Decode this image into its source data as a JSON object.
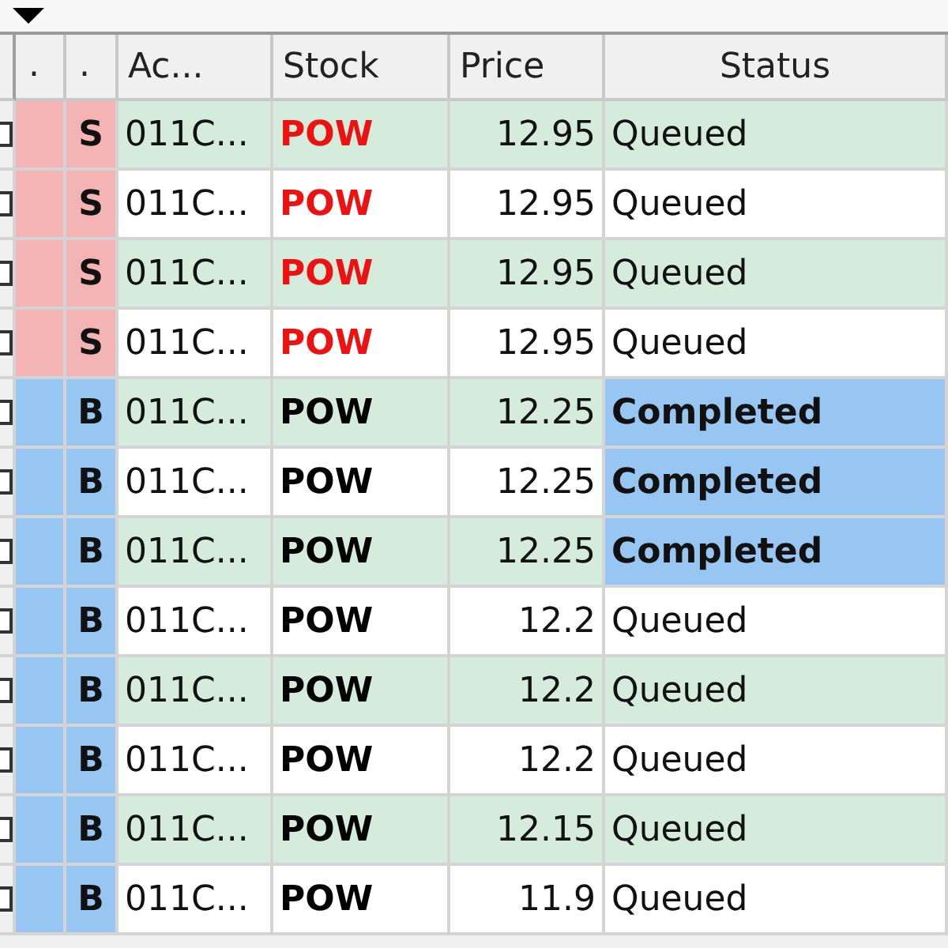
{
  "columns": [
    ".",
    ".",
    "Ac...",
    "Stock",
    "Price",
    "Status"
  ],
  "rows": [
    {
      "kind": "sell",
      "checked": false,
      "side": "S",
      "account": "011C...",
      "stock": "POW",
      "price": "12.95",
      "status": "Queued",
      "completed": false
    },
    {
      "kind": "sell",
      "checked": false,
      "side": "S",
      "account": "011C...",
      "stock": "POW",
      "price": "12.95",
      "status": "Queued",
      "completed": false
    },
    {
      "kind": "sell",
      "checked": false,
      "side": "S",
      "account": "011C...",
      "stock": "POW",
      "price": "12.95",
      "status": "Queued",
      "completed": false
    },
    {
      "kind": "sell",
      "checked": false,
      "side": "S",
      "account": "011C...",
      "stock": "POW",
      "price": "12.95",
      "status": "Queued",
      "completed": false
    },
    {
      "kind": "buy",
      "checked": false,
      "side": "B",
      "account": "011C...",
      "stock": "POW",
      "price": "12.25",
      "status": "Completed",
      "completed": true
    },
    {
      "kind": "buy",
      "checked": false,
      "side": "B",
      "account": "011C...",
      "stock": "POW",
      "price": "12.25",
      "status": "Completed",
      "completed": true
    },
    {
      "kind": "buy",
      "checked": false,
      "side": "B",
      "account": "011C...",
      "stock": "POW",
      "price": "12.25",
      "status": "Completed",
      "completed": true
    },
    {
      "kind": "buy",
      "checked": false,
      "side": "B",
      "account": "011C...",
      "stock": "POW",
      "price": "12.2",
      "status": "Queued",
      "completed": false
    },
    {
      "kind": "buy",
      "checked": false,
      "side": "B",
      "account": "011C...",
      "stock": "POW",
      "price": "12.2",
      "status": "Queued",
      "completed": false
    },
    {
      "kind": "buy",
      "checked": false,
      "side": "B",
      "account": "011C...",
      "stock": "POW",
      "price": "12.2",
      "status": "Queued",
      "completed": false
    },
    {
      "kind": "buy",
      "checked": false,
      "side": "B",
      "account": "011C...",
      "stock": "POW",
      "price": "12.15",
      "status": "Queued",
      "completed": false
    },
    {
      "kind": "buy",
      "checked": false,
      "side": "B",
      "account": "011C...",
      "stock": "POW",
      "price": "11.9",
      "status": "Queued",
      "completed": false
    }
  ]
}
